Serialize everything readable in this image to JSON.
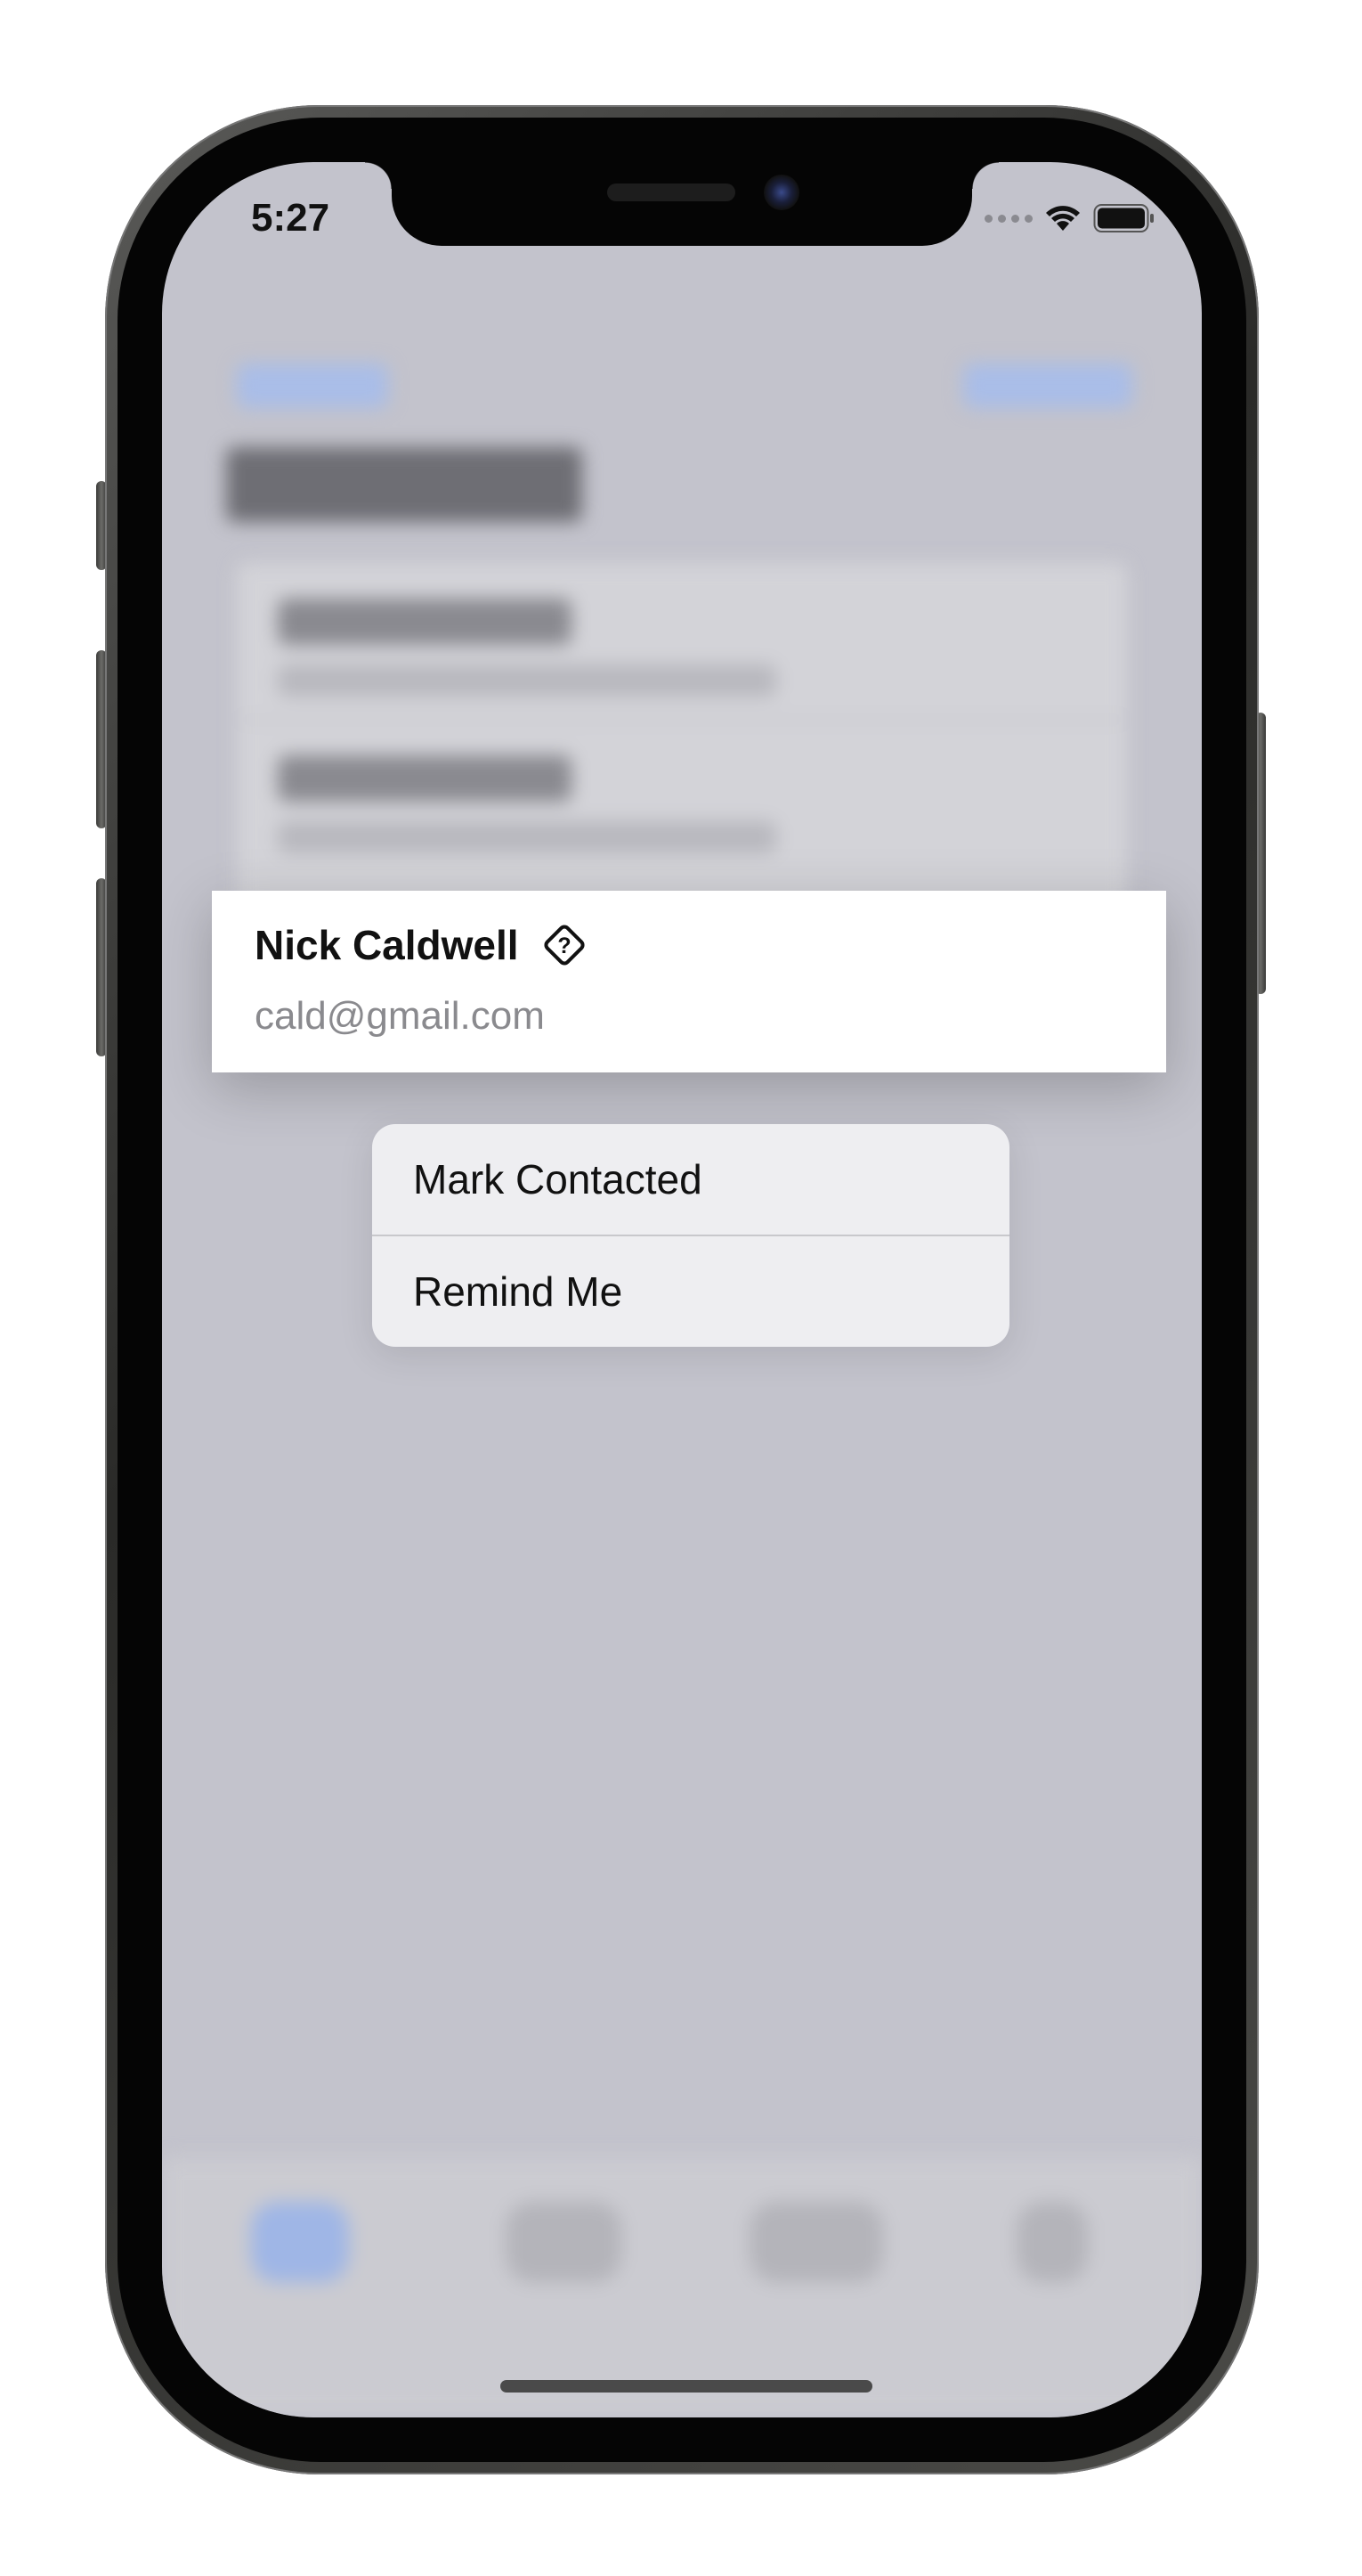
{
  "status_bar": {
    "time": "5:27",
    "signal_icon": "signal-dots-icon",
    "wifi_icon": "wifi-icon",
    "battery_icon": "battery-icon"
  },
  "contact_preview": {
    "name": "Nick Caldwell",
    "email": "cald@gmail.com",
    "status_icon": "question-diamond-icon"
  },
  "context_menu": {
    "items": [
      {
        "label": "Mark Contacted"
      },
      {
        "label": "Remind Me"
      }
    ]
  },
  "colors": {
    "screen_background": "#c3c3cc",
    "card_background": "#ffffff",
    "menu_background": "#eeeef1",
    "blurred_accent": "#9fb6e6"
  }
}
